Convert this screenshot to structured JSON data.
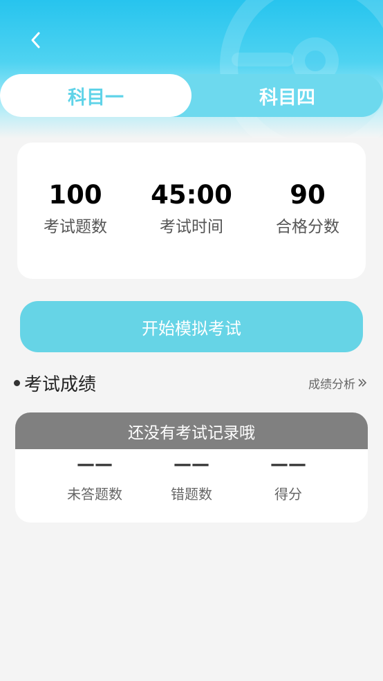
{
  "nav": {
    "back_icon": "chevron-left-icon"
  },
  "tabs": [
    {
      "label": "科目一",
      "active": true
    },
    {
      "label": "科目四",
      "active": false
    }
  ],
  "exam_info": {
    "stats": [
      {
        "value": "100",
        "label": "考试题数"
      },
      {
        "value": "45:00",
        "label": "考试时间"
      },
      {
        "value": "90",
        "label": "合格分数"
      }
    ]
  },
  "start_button": {
    "label": "开始模拟考试"
  },
  "results": {
    "title": "考试成绩",
    "analysis_link": "成绩分析",
    "empty_message": "还没有考试记录哦",
    "stats": [
      {
        "value": "——",
        "label": "未答题数"
      },
      {
        "value": "——",
        "label": "错题数"
      },
      {
        "value": "——",
        "label": "得分"
      }
    ]
  },
  "colors": {
    "accent": "#5fd3e8",
    "header_blue": "#27c4ee",
    "start_button": "#66d4e6",
    "record_header": "#808080",
    "background": "#f4f4f4"
  }
}
